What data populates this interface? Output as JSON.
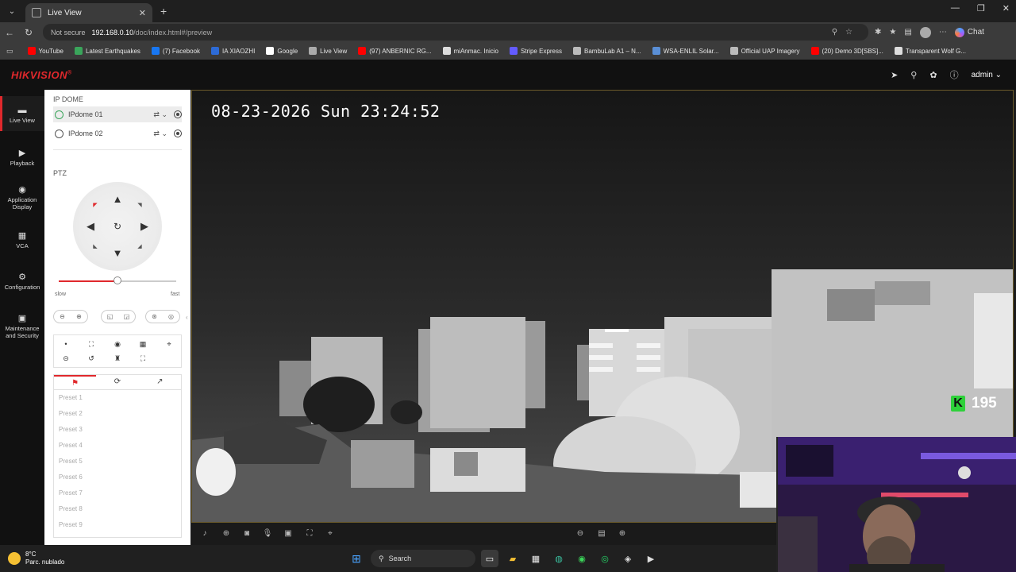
{
  "browser": {
    "tab_title": "Live View",
    "security_label": "Not secure",
    "url_host": "192.168.0.10",
    "url_path": "/doc/index.html#/preview",
    "chat_label": "Chat",
    "bookmarks": [
      {
        "label": "YouTube",
        "color": "#ff0000"
      },
      {
        "label": "Latest Earthquakes",
        "color": "#3aa55b"
      },
      {
        "label": "(7) Facebook",
        "color": "#1877f2"
      },
      {
        "label": "IA XIAOZHI",
        "color": "#2d6bd6"
      },
      {
        "label": "Google",
        "color": "#ffffff"
      },
      {
        "label": "Live View",
        "color": "#aaaaaa"
      },
      {
        "label": "(97) ANBERNIC RG...",
        "color": "#ff0000"
      },
      {
        "label": "miAnmac. Inicio",
        "color": "#dddddd"
      },
      {
        "label": "Stripe Express",
        "color": "#635bff"
      },
      {
        "label": "BambuLab A1 – N...",
        "color": "#bbbbbb"
      },
      {
        "label": "WSA-ENLIL Solar...",
        "color": "#5a8fd6"
      },
      {
        "label": "Official UAP Imagery",
        "color": "#bbbbbb"
      },
      {
        "label": "(20) Demo 3D[SBS]...",
        "color": "#ff0000"
      },
      {
        "label": "Transparent Wolf G...",
        "color": "#dddddd"
      }
    ]
  },
  "app": {
    "brand": "HIKVISION",
    "brand_reg": "®",
    "user": "admin",
    "accent": "#e0282c"
  },
  "nav": [
    {
      "label": "Live View",
      "icon": "live-view-icon",
      "active": true
    },
    {
      "label": "Playback",
      "icon": "playback-icon"
    },
    {
      "label": "Application Display",
      "icon": "application-icon"
    },
    {
      "label": "VCA",
      "icon": "vca-icon"
    },
    {
      "label": "Configuration",
      "icon": "gear-icon"
    },
    {
      "label": "Maintenance and Security",
      "icon": "maintenance-icon"
    }
  ],
  "panel": {
    "group_title": "IP DOME",
    "cameras": [
      {
        "name": "IPdome 01",
        "selected": true
      },
      {
        "name": "IPdome 02",
        "selected": false
      }
    ],
    "ptz_label": "PTZ",
    "speed_slow": "slow",
    "speed_fast": "fast",
    "speed_level": 0.5,
    "presets": [
      "Preset 1",
      "Preset 2",
      "Preset 3",
      "Preset 4",
      "Preset 5",
      "Preset 6",
      "Preset 7",
      "Preset 8",
      "Preset 9"
    ]
  },
  "video": {
    "osd_datetime": "08-23-2026 Sun 23:24:52",
    "overlay_count": "195"
  },
  "taskbar": {
    "temperature": "8°C",
    "weather": "Parc. nublado",
    "search_label": "Search"
  }
}
